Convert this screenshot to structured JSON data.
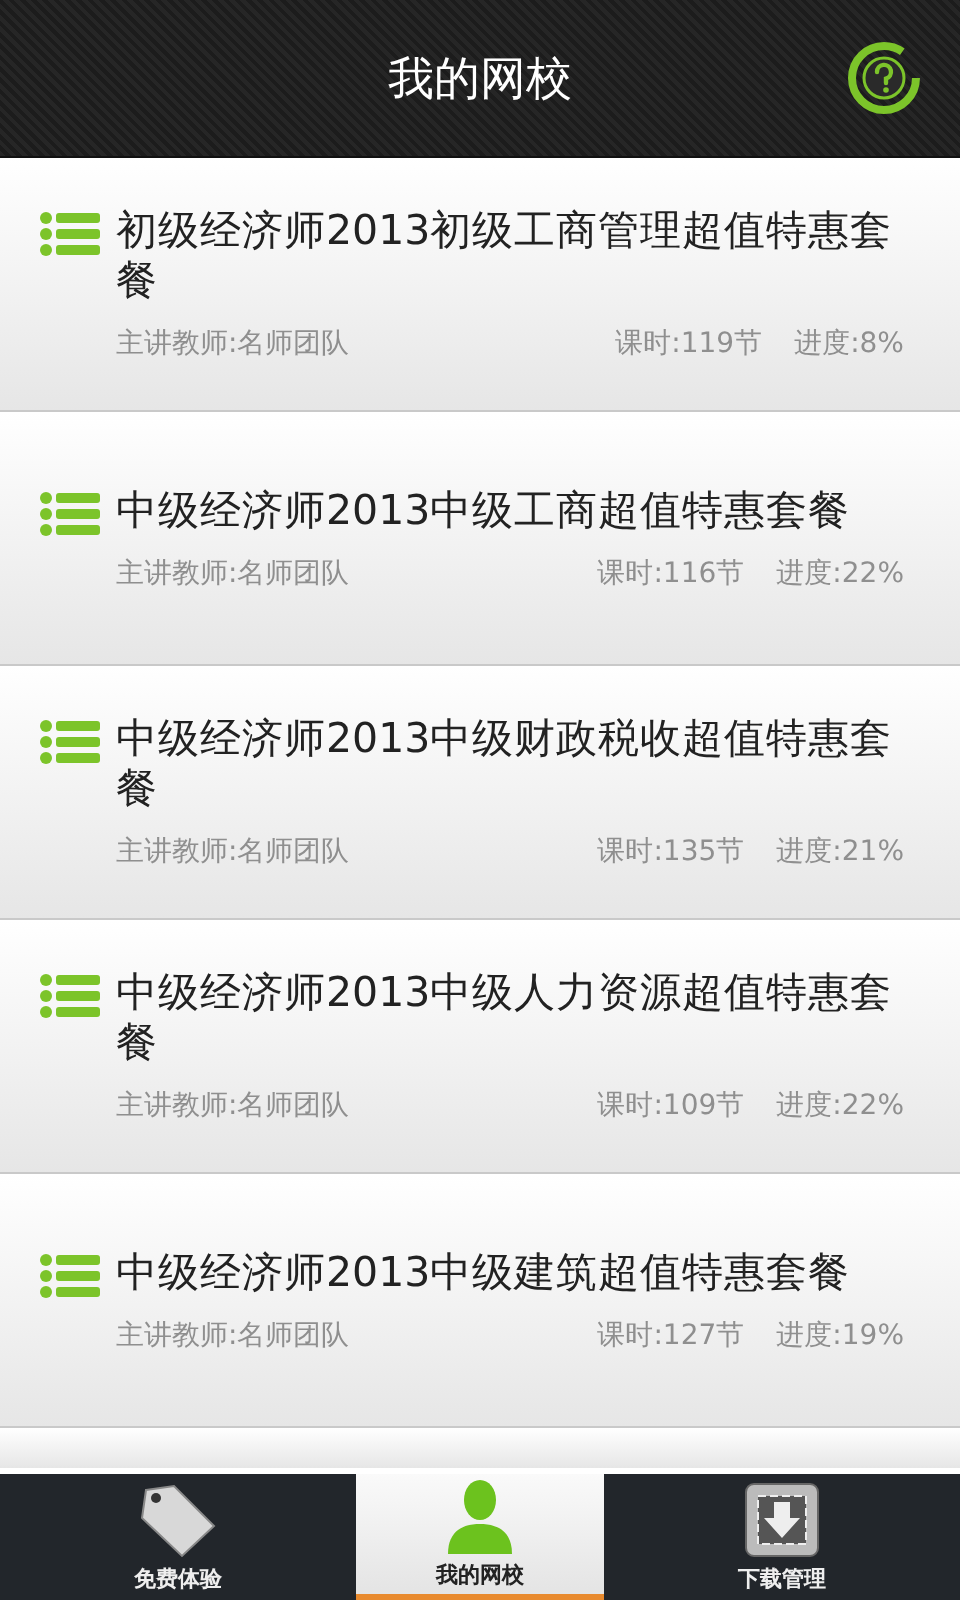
{
  "header": {
    "title": "我的网校"
  },
  "courses": [
    {
      "title": "初级经济师2013初级工商管理超值特惠套餐",
      "teacher": "主讲教师:名师团队",
      "lessons": "课时:119节",
      "progress": "进度:8%"
    },
    {
      "title": "中级经济师2013中级工商超值特惠套餐",
      "teacher": "主讲教师:名师团队",
      "lessons": "课时:116节",
      "progress": "进度:22%"
    },
    {
      "title": "中级经济师2013中级财政税收超值特惠套餐",
      "teacher": "主讲教师:名师团队",
      "lessons": "课时:135节",
      "progress": "进度:21%"
    },
    {
      "title": "中级经济师2013中级人力资源超值特惠套餐",
      "teacher": "主讲教师:名师团队",
      "lessons": "课时:109节",
      "progress": "进度:22%"
    },
    {
      "title": "中级经济师2013中级建筑超值特惠套餐",
      "teacher": "主讲教师:名师团队",
      "lessons": "课时:127节",
      "progress": "进度:19%"
    }
  ],
  "tabs": [
    {
      "kind": "sale",
      "label": "免费体验",
      "selected": false
    },
    {
      "kind": "person",
      "label": "我的网校",
      "selected": true
    },
    {
      "kind": "download",
      "label": "下载管理",
      "selected": false
    }
  ]
}
